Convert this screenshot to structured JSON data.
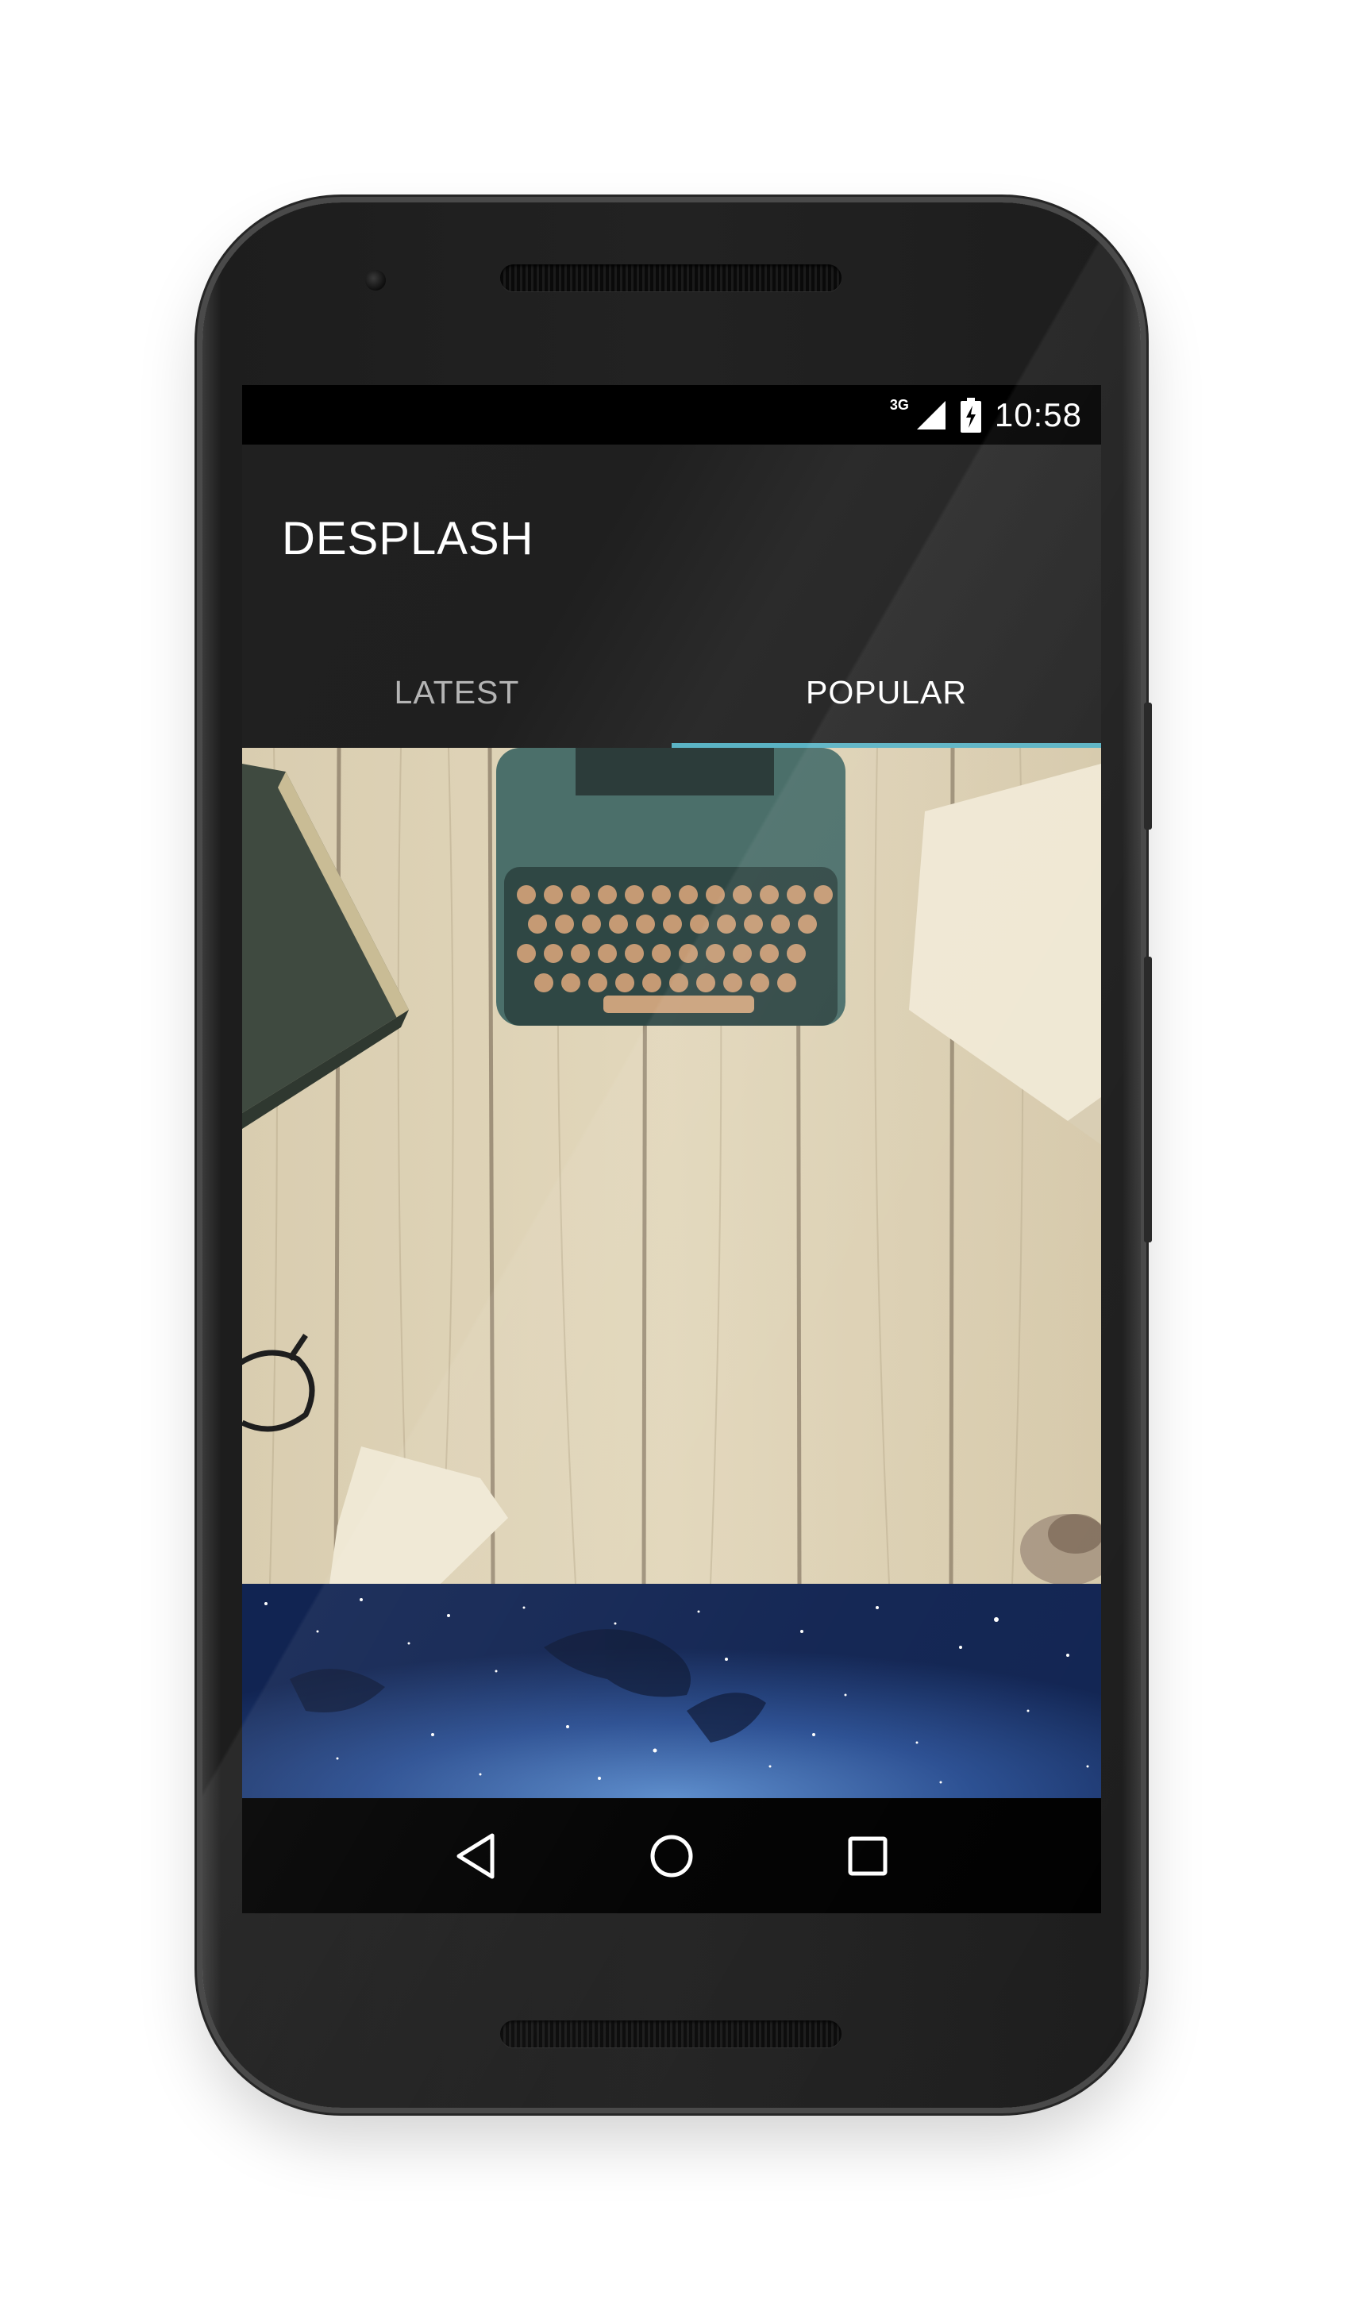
{
  "status_bar": {
    "network": "3G",
    "time": "10:58"
  },
  "app_bar": {
    "title": "DESPLASH"
  },
  "tabs": [
    {
      "label": "LATEST",
      "selected": false
    },
    {
      "label": "POPULAR",
      "selected": true
    }
  ],
  "colors": {
    "tab_indicator": "#5bb3c4",
    "app_bar": "#212121",
    "status_bar": "#000000"
  },
  "photos": [
    {
      "subject": "typewriter-on-wooden-desk"
    },
    {
      "subject": "starry-night-sky"
    }
  ],
  "nav_bar": {
    "buttons": [
      "back-icon",
      "home-icon",
      "recents-icon"
    ]
  }
}
